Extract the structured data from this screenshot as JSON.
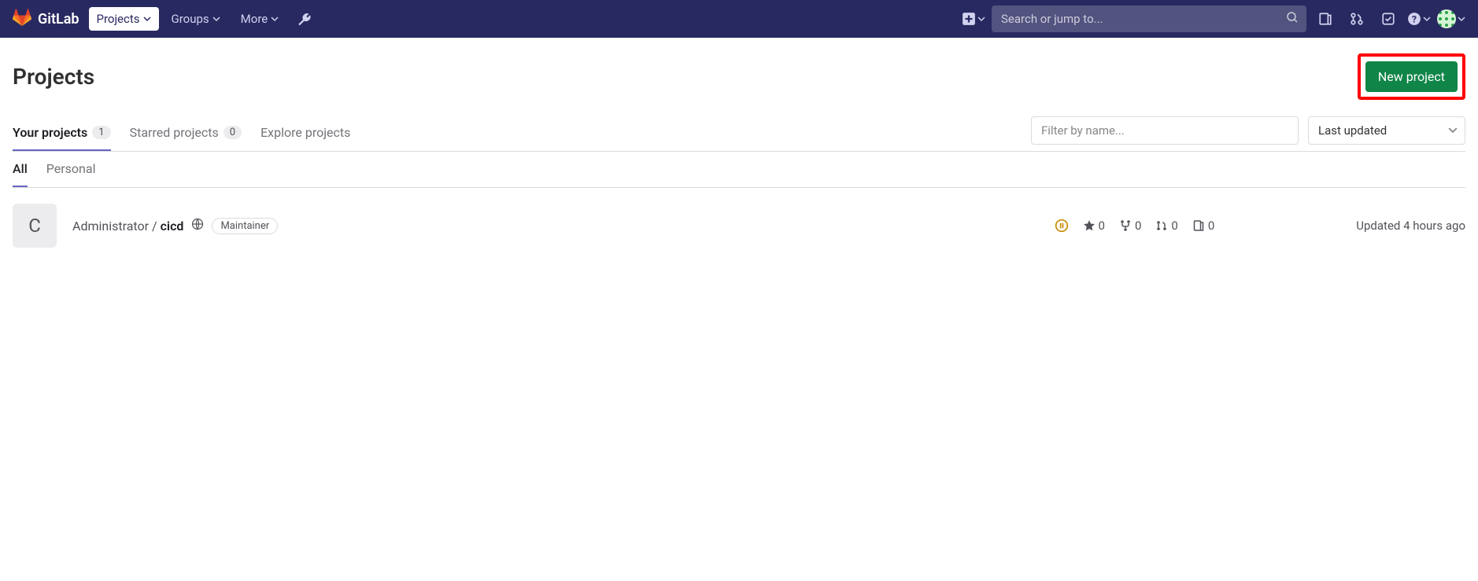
{
  "brand": "GitLab",
  "nav": {
    "projects": "Projects",
    "groups": "Groups",
    "more": "More"
  },
  "search": {
    "placeholder": "Search or jump to..."
  },
  "page": {
    "title": "Projects",
    "new_project": "New project"
  },
  "tabs": {
    "your_projects": "Your projects",
    "your_count": "1",
    "starred": "Starred projects",
    "starred_count": "0",
    "explore": "Explore projects",
    "filter_placeholder": "Filter by name...",
    "sort": "Last updated"
  },
  "subtabs": {
    "all": "All",
    "personal": "Personal"
  },
  "project": {
    "initial": "C",
    "namespace": "Administrator / ",
    "name": "cicd",
    "role": "Maintainer",
    "stars": "0",
    "forks": "0",
    "merge_requests": "0",
    "issues": "0",
    "updated": "Updated 4 hours ago"
  }
}
